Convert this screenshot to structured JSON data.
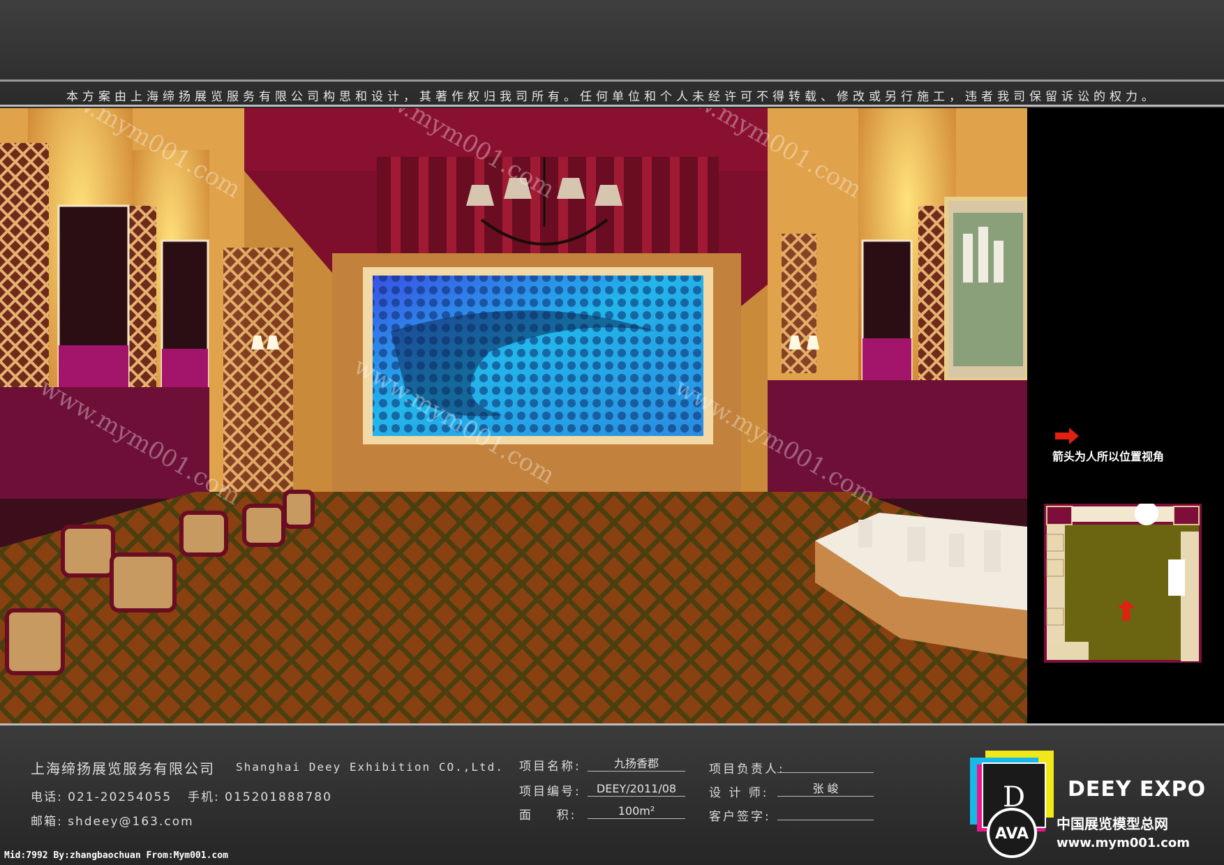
{
  "header": {
    "copyright_notice": "本方案由上海缔扬展览服务有限公司构思和设计，其著作权归我司所有。任何单位和个人未经许可不得转载、修改或另行施工，违者我司保留诉讼的权力。"
  },
  "side_panel": {
    "arrow_note": "箭头为人所以位置视角",
    "arrow_color": "#e02010"
  },
  "company": {
    "name_cn": "上海缔扬展览服务有限公司",
    "name_en": "Shanghai Deey Exhibition CO.,Ltd.",
    "phone": "电话: 021-20254055",
    "mobile": "手机: 015201888780",
    "email": "邮箱: shdeey@163.com"
  },
  "project": {
    "name_label": "项目名称:",
    "name_value": "九扬香郡",
    "number_label": "项目编号:",
    "number_value": "DEEY/2011/08",
    "area_label": "面    积:",
    "area_value": "100m²",
    "manager_label": "项目负责人:",
    "manager_value": "",
    "designer_label": "设 计 师:",
    "designer_value": "张 峻",
    "client_label": "客户签字:",
    "client_value": ""
  },
  "credit": "Mid:7992 By:zhangbaochuan From:Mym001.com",
  "brand": {
    "logo_letter": "D",
    "logo_mark": "AVA",
    "name": "DEEY EXPO",
    "tagline_cn": "中国展览模型总网",
    "url": "www.mym001.com"
  },
  "watermark": "www.mym001.com",
  "colors": {
    "burgundy": "#7a0f3c",
    "gold_wall": "#e8a94a",
    "screen_blue": "#1aa6e8",
    "carpet": "#9a4a12"
  }
}
